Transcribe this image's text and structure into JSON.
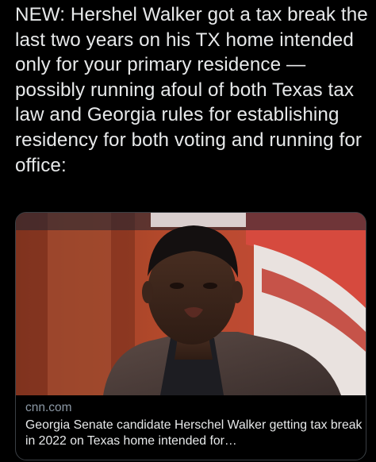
{
  "tweet": {
    "text": "NEW: Hershel Walker got a tax break the last two years on his TX home intended only for your primary residence — possibly running afoul of both Texas tax law and Georgia rules for establishing residency for both voting and running for office:"
  },
  "link_card": {
    "domain": "cnn.com",
    "title": "Georgia Senate candidate Herschel Walker getting tax break in 2022 on Texas home intended for…",
    "image_description_icon": "news-photo"
  },
  "colors": {
    "background": "#000000",
    "text_primary": "#e7e9ea",
    "text_secondary": "#8b98a5",
    "card_border": "#3a3f44"
  }
}
